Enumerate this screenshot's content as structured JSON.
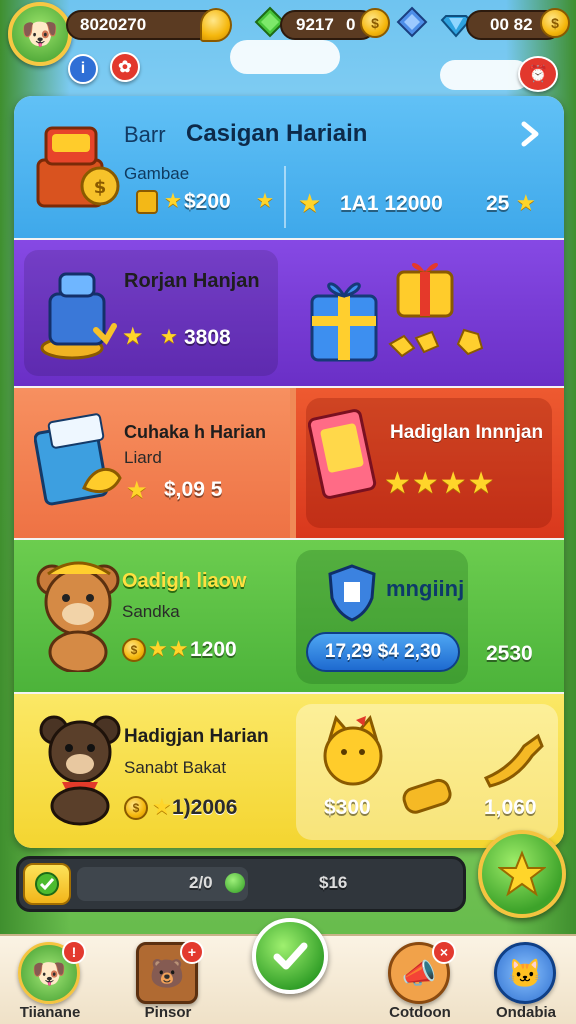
{
  "top_bar": {
    "gold_amount": "8020270",
    "green_gem_amount": "9217",
    "green_gem_secondary": "0",
    "blue_gem_amount": "00 82",
    "coin_symbol": "$"
  },
  "header": {
    "prefix": "Barr",
    "title": "Casigan Hariain"
  },
  "row1": {
    "left_sub": "Gambae",
    "left_value": "$200",
    "middle_value": "1A1 12000",
    "right_value": "25"
  },
  "row2": {
    "left_title": "Rorjan Hanjan",
    "left_value": "3808"
  },
  "row3": {
    "left_title": "Cuhaka h Harian",
    "left_sub": "Liard",
    "left_value": "$,09 5",
    "right_title": "Hadiglan Innnjan"
  },
  "row4": {
    "left_title": "Oadigh liaow",
    "left_sub": "Sandka",
    "left_value": "1200",
    "right_title": "mngiinj",
    "right_button": "17,29 $4 2,30",
    "right_value": "2530"
  },
  "row5": {
    "left_title": "Hadigjan Harian",
    "left_sub": "Sanabt Bakat",
    "left_value": "1)2006",
    "middle_value": "$300",
    "right_value": "1,060"
  },
  "progress": {
    "label_left": "2/0",
    "label_right": "$16",
    "fraction": 0.45
  },
  "bottom_nav": [
    {
      "label": "Tiianane",
      "badge": "!"
    },
    {
      "label": "Pinsor",
      "badge": "+"
    },
    {
      "label": "Cotdoon",
      "badge": "×"
    },
    {
      "label": "Ondabia",
      "badge": ""
    }
  ],
  "colors": {
    "row1": "#5bb8f0",
    "row2": "#7a3fd6",
    "row3_left": "#f27a4a",
    "row3_right": "#e84a2a",
    "row4": "#58c043",
    "row5": "#f7e04a"
  }
}
